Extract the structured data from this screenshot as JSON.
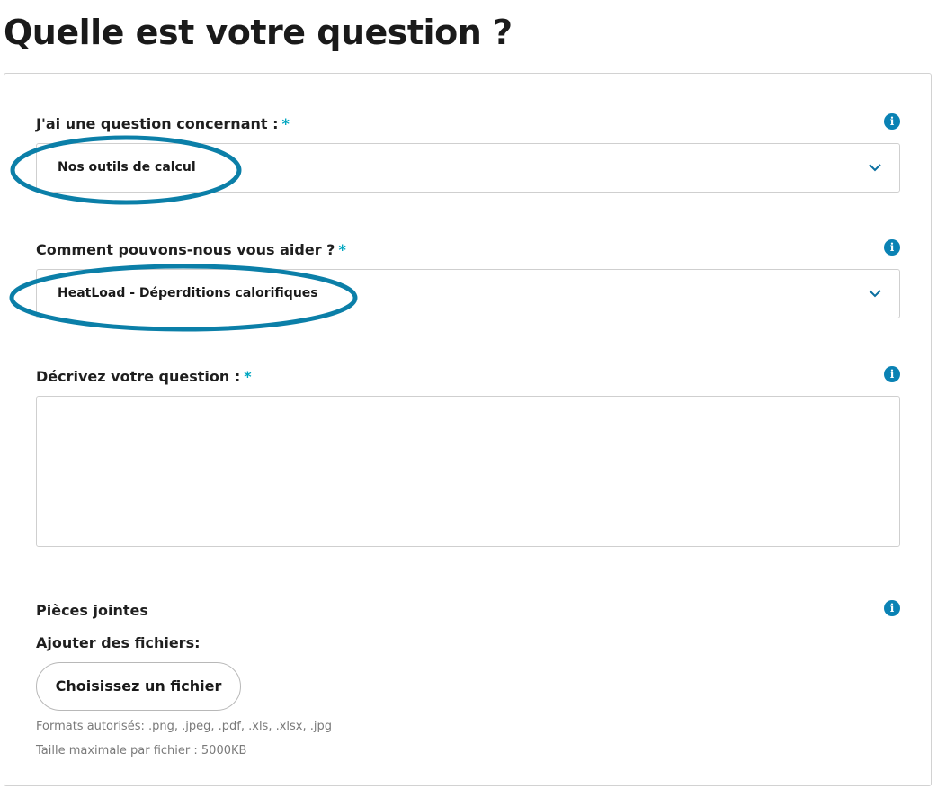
{
  "page": {
    "title": "Quelle est votre question ?"
  },
  "form": {
    "topic": {
      "label": "J'ai une question concernant :",
      "required_mark": "*",
      "value": "Nos outils de calcul",
      "info_icon": "info-icon"
    },
    "help": {
      "label": "Comment pouvons-nous vous aider ?",
      "required_mark": "*",
      "value": "HeatLoad - Déperditions calorifiques",
      "info_icon": "info-icon"
    },
    "description": {
      "label": "Décrivez votre question :",
      "required_mark": "*",
      "value": "",
      "info_icon": "info-icon"
    },
    "attachments": {
      "label": "Pièces jointes",
      "add_label": "Ajouter des fichiers:",
      "button_label": "Choisissez un fichier",
      "formats": "Formats autorisés: .png, .jpeg, .pdf, .xls, .xlsx, .jpg",
      "max_size": "Taille maximale par fichier : 5000KB",
      "info_icon": "info-icon"
    }
  },
  "colors": {
    "accent": "#0a82b4",
    "required": "#00a6c0",
    "annotation": "#0b7fa8"
  }
}
